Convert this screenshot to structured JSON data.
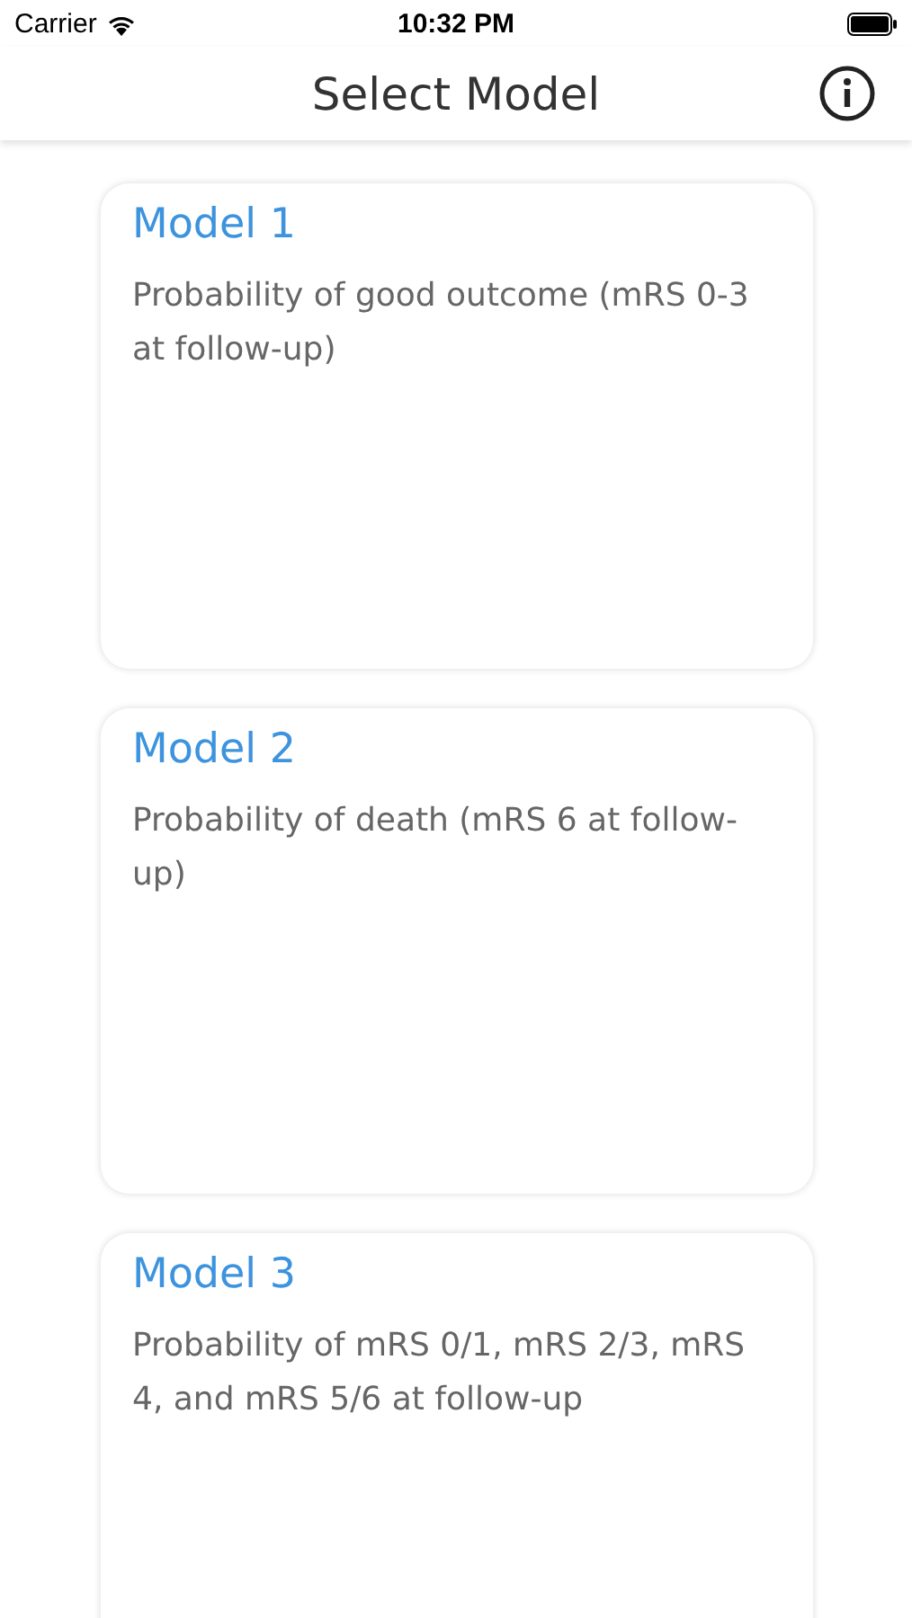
{
  "status_bar": {
    "carrier": "Carrier",
    "time": "10:32 PM"
  },
  "nav_bar": {
    "title": "Select Model"
  },
  "models": [
    {
      "title": "Model 1",
      "description": "Probability of good outcome (mRS 0-3 at follow-up)"
    },
    {
      "title": "Model 2",
      "description": "Probability of death (mRS 6 at follow-up)"
    },
    {
      "title": "Model 3",
      "description": "Probability of mRS 0/1, mRS 2/3, mRS 4, and mRS 5/6 at follow-up"
    }
  ]
}
